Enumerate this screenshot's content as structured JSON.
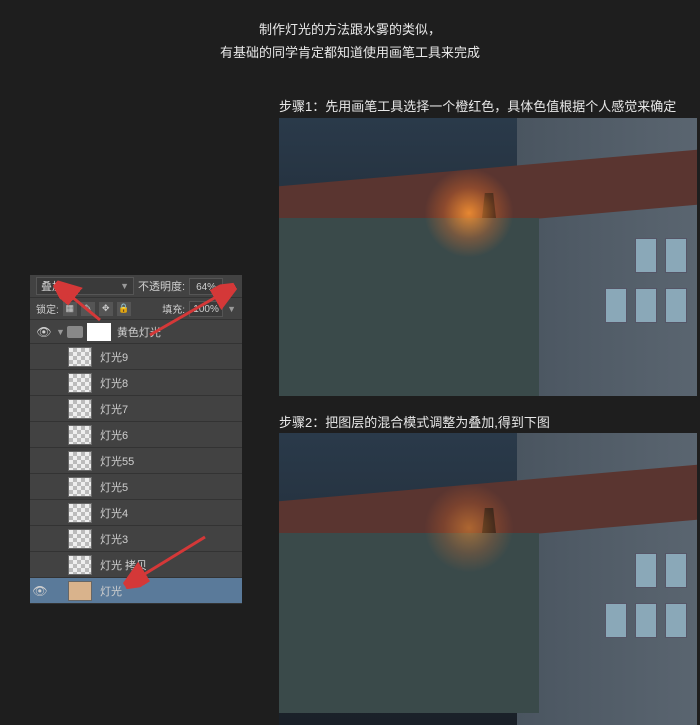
{
  "header": {
    "line1": "制作灯光的方法跟水雾的类似，",
    "line2": "有基础的同学肯定都知道使用画笔工具来完成"
  },
  "steps": {
    "step1": "步骤1：先用画笔工具选择一个橙红色，具体色值根据个人感觉来确定",
    "step2": "步骤2：把图层的混合模式调整为叠加,得到下图"
  },
  "panel": {
    "blend_mode": "叠加",
    "opacity_label": "不透明度:",
    "opacity_value": "64%",
    "lock_label": "锁定:",
    "fill_label": "填充:",
    "fill_value": "100%",
    "group_name": "黄色灯光",
    "layers": [
      {
        "name": "灯光9"
      },
      {
        "name": "灯光8"
      },
      {
        "name": "灯光7"
      },
      {
        "name": "灯光6"
      },
      {
        "name": "灯光55"
      },
      {
        "name": "灯光5"
      },
      {
        "name": "灯光4"
      },
      {
        "name": "灯光3"
      },
      {
        "name": "灯光 拷贝"
      },
      {
        "name": "灯光"
      }
    ]
  }
}
